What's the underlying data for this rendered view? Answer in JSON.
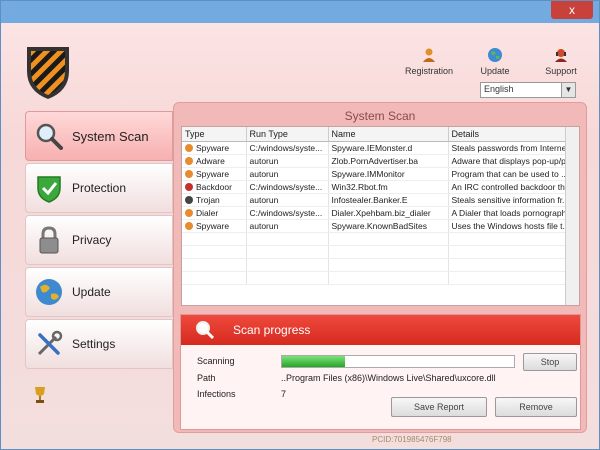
{
  "titlebar": {
    "close_label": "x"
  },
  "toplinks": [
    {
      "label": "Registration"
    },
    {
      "label": "Update"
    },
    {
      "label": "Support"
    }
  ],
  "language": {
    "selected": "English"
  },
  "sidebar": {
    "items": [
      {
        "label": "System Scan",
        "icon": "magnifier-icon",
        "active": true
      },
      {
        "label": "Protection",
        "icon": "shield-check-icon"
      },
      {
        "label": "Privacy",
        "icon": "padlock-icon"
      },
      {
        "label": "Update",
        "icon": "globe-icon"
      },
      {
        "label": "Settings",
        "icon": "tools-icon"
      }
    ]
  },
  "panel": {
    "title": "System Scan"
  },
  "table": {
    "headers": [
      "Type",
      "Run Type",
      "Name",
      "Details"
    ],
    "rows": [
      {
        "type": "Spyware",
        "run": "C:/windows/syste...",
        "name": "Spyware.IEMonster.d",
        "details": "Steals passwords from Interne...",
        "color": "#e98a2e"
      },
      {
        "type": "Adware",
        "run": "autorun",
        "name": "Zlob.PornAdvertiser.ba",
        "details": "Adware that displays pop-up/p...",
        "color": "#e98a2e"
      },
      {
        "type": "Spyware",
        "run": "autorun",
        "name": "Spyware.IMMonitor",
        "details": "Program that can be used to ...",
        "color": "#e98a2e"
      },
      {
        "type": "Backdoor",
        "run": "C:/windows/syste...",
        "name": "Win32.Rbot.fm",
        "details": "An IRC controlled backdoor th...",
        "color": "#c23030"
      },
      {
        "type": "Trojan",
        "run": "autorun",
        "name": "Infostealer.Banker.E",
        "details": "Steals sensitive information fr...",
        "color": "#444444"
      },
      {
        "type": "Dialer",
        "run": "C:/windows/syste...",
        "name": "Dialer.Xpehbam.biz_dialer",
        "details": "A Dialer that loads pornographi...",
        "color": "#e98a2e"
      },
      {
        "type": "Spyware",
        "run": "autorun",
        "name": "Spyware.KnownBadSites",
        "details": "Uses the Windows hosts file t...",
        "color": "#e98a2e"
      }
    ]
  },
  "progress": {
    "title": "Scan progress",
    "scanning_label": "Scanning",
    "path_label": "Path",
    "path_value": "..Program Files (x86)\\Windows Live\\Shared\\uxcore.dll",
    "infections_label": "Infections",
    "infections_value": "7",
    "fill_fraction": 0.27,
    "stop_label": "Stop",
    "save_report_label": "Save Report",
    "remove_label": "Remove"
  },
  "pcid": "PCID:701985476F798",
  "colors": {
    "accent": "#d6291f",
    "panel": "#f2b9b9",
    "titlebar": "#73aae0"
  }
}
